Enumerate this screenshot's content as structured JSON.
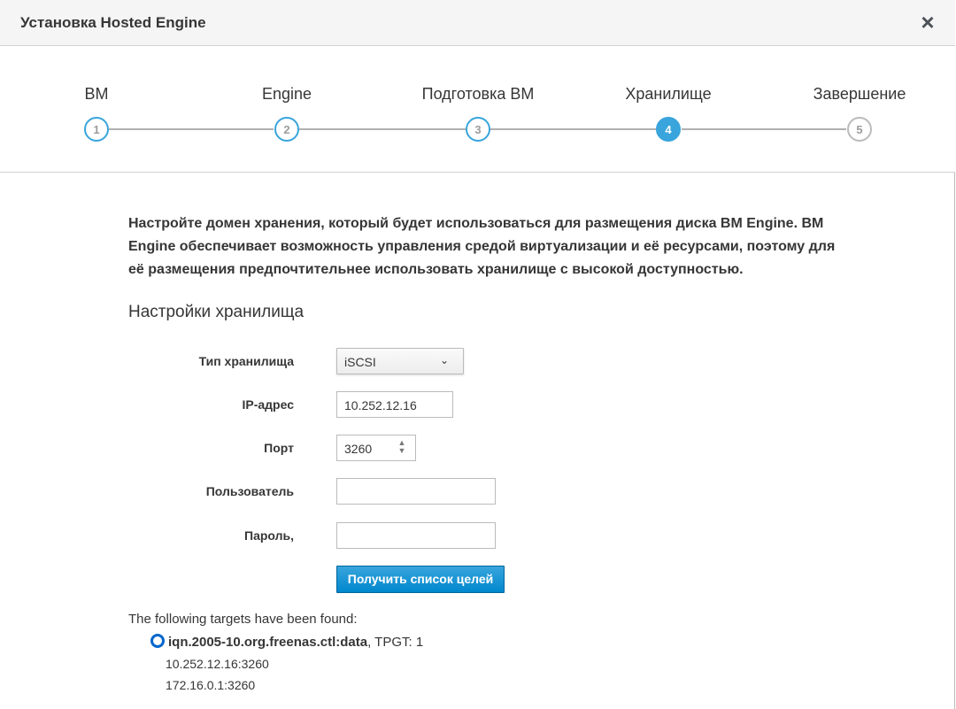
{
  "dialog": {
    "title": "Установка Hosted Engine",
    "close_icon": "close-icon"
  },
  "wizard": {
    "steps": [
      {
        "label": "ВМ",
        "number": "1",
        "state": "done"
      },
      {
        "label": "Engine",
        "number": "2",
        "state": "done"
      },
      {
        "label": "Подготовка ВМ",
        "number": "3",
        "state": "done"
      },
      {
        "label": "Хранилище",
        "number": "4",
        "state": "active"
      },
      {
        "label": "Завершение",
        "number": "5",
        "state": "future"
      }
    ]
  },
  "intro": "Настройте домен хранения, который будет использоваться для размещения диска ВМ Engine. ВМ Engine обеспечивает возможность управления средой виртуализации и её ресурсами, поэтому для её размещения предпочтительнее использовать хранилище с высокой доступностью.",
  "section_title": "Настройки хранилища",
  "form": {
    "storage_type_label": "Тип хранилища",
    "storage_type_value": "iSCSI",
    "ip_label": "IP-адрес",
    "ip_value": "10.252.12.16",
    "port_label": "Порт",
    "port_value": "3260",
    "user_label": "Пользователь",
    "user_value": "",
    "password_label": "Пароль,",
    "password_value": "",
    "retrieve_button": "Получить список целей"
  },
  "targets": {
    "found_text": "The following targets have been found:",
    "items": [
      {
        "name": "iqn.2005-10.org.freenas.ctl:data",
        "tpgt": ", TPGT: 1",
        "portals": [
          "10.252.12.16:3260",
          "172.16.0.1:3260"
        ]
      }
    ]
  },
  "colors": {
    "accent": "#39a5dc",
    "primary_button": "#0088ce",
    "radio": "#0066cc"
  }
}
